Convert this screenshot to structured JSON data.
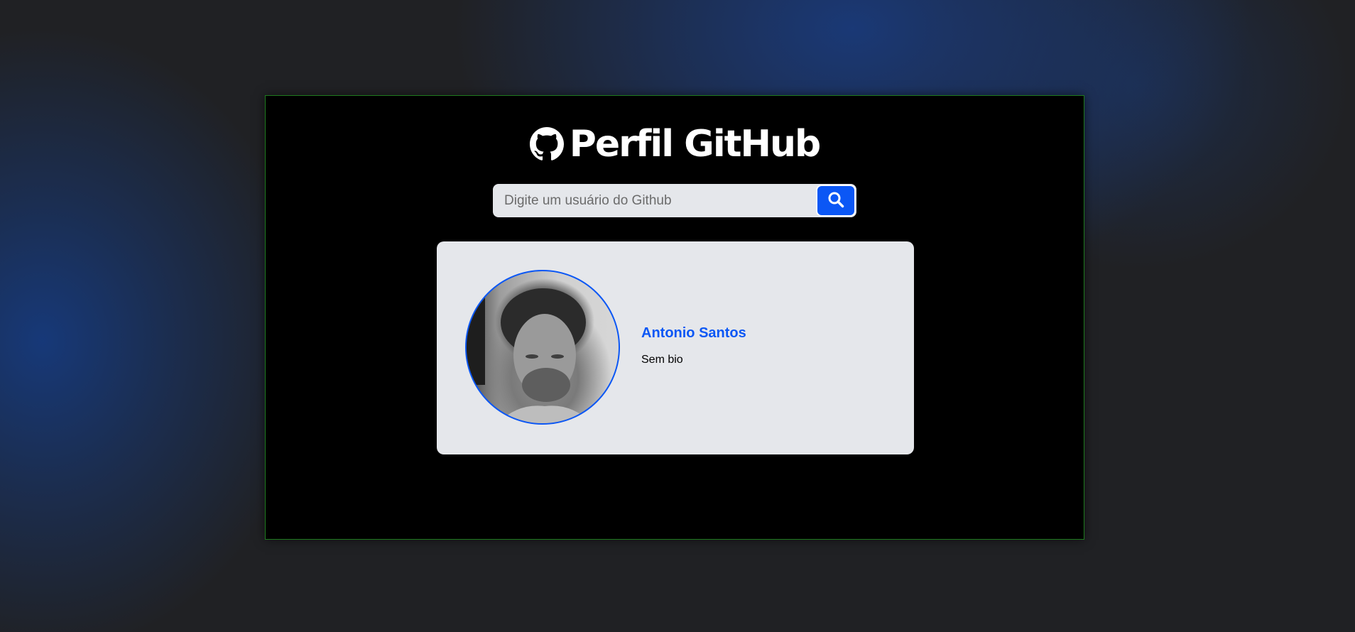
{
  "header": {
    "title": "Perfil GitHub",
    "logo_icon": "github-icon"
  },
  "search": {
    "placeholder": "Digite um usuário do Github",
    "value": "",
    "button_icon": "search-icon"
  },
  "profile": {
    "name": "Antonio Santos",
    "bio": "Sem bio",
    "avatar_alt": "avatar"
  },
  "colors": {
    "accent": "#0b57f5",
    "panel": "#000000",
    "card": "#e5e7eb",
    "page_background": "#202124"
  }
}
